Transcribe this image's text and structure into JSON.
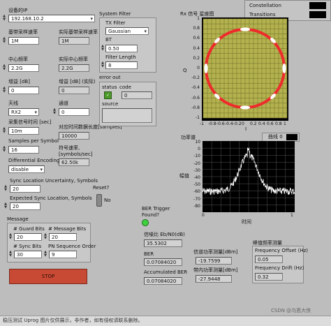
{
  "left": {
    "device_ip": {
      "label": "设备的IP",
      "value": "192.168.10.2"
    },
    "baseband_rate": {
      "label": "基带采样速率",
      "value": "1M"
    },
    "actual_baseband_rate": {
      "label": "实际基带采样速率",
      "value": "1M"
    },
    "center_freq": {
      "label": "中心频率",
      "value": "2.2G"
    },
    "actual_center_freq": {
      "label": "实际中心频率",
      "value": "2.2G"
    },
    "gain": {
      "label": "增益 [dB]",
      "value": "0"
    },
    "actual_gain": {
      "label": "增益 [dB] (实际)",
      "value": "0"
    },
    "antenna": {
      "label": "天线",
      "value": "RX2"
    },
    "channel": {
      "label": "通道",
      "value": "0"
    },
    "capture_time": {
      "label": "采集信号时间 [sec]",
      "value": "10m"
    },
    "record_length": {
      "label": "对应时间数据长度[samples]",
      "value": "10000"
    },
    "samples_per_symbol": {
      "label": "Samples per Symbol",
      "value": "16"
    },
    "symbol_rate": {
      "label": "符号速率,\n[symbols/sec]",
      "value": "62.50k"
    },
    "diff_encoding": {
      "label": "Differential Encoding",
      "value": "disable"
    },
    "sync_uncertainty": {
      "label": "Sync Location Uncertainty, Symbols",
      "value": "20"
    },
    "reset": {
      "label": "Reset?",
      "state": "No"
    },
    "expected_sync": {
      "label": "Expected Sync Location, Symbols",
      "value": "20"
    }
  },
  "message": {
    "title": "Message",
    "guard_bits": {
      "label": "# Guard Bits",
      "value": "20"
    },
    "message_bits": {
      "label": "# Message Bits",
      "value": "20"
    },
    "sync_bits": {
      "label": "# Sync Bits",
      "value": "30"
    },
    "pn_order": {
      "label": "PN Sequence Order",
      "value": "9"
    }
  },
  "stop_label": "STOP",
  "filter": {
    "title": "System Filter",
    "tx_label": "TX Filter",
    "tx_value": "Gaussian",
    "bt_label": "BT",
    "bt_value": "0.50",
    "len_label": "Filter Length",
    "len_value": "8"
  },
  "error": {
    "title": "error out",
    "status_label": "status",
    "code_label": "code",
    "code_value": "0",
    "source_label": "source"
  },
  "constellation": {
    "title": "Rx 信号 星座图",
    "legend": [
      "Constellation",
      "Transitions"
    ],
    "ylabel": "Q",
    "xlabel": "I",
    "xticks": [
      "-1",
      "-0.8",
      "-0.6",
      "-0.4",
      "-0.2",
      "0",
      "0.2",
      "0.4",
      "0.6",
      "0.8",
      "1"
    ],
    "yticks": [
      "1",
      "0.8",
      "0.6",
      "0.4",
      "0.2",
      "0",
      "-0.2",
      "-0.4",
      "-0.6",
      "-0.8",
      "-1"
    ]
  },
  "spectrum": {
    "title": "功率谱",
    "legend": "曲线 0",
    "ylabel": "幅值",
    "xlabel": "时间",
    "xticks": [
      "0",
      "1"
    ],
    "yticks": [
      "10",
      "0",
      "-10",
      "-20",
      "-30",
      "-40",
      "-50",
      "-60",
      "-70",
      "-80"
    ]
  },
  "ber": {
    "trigger_label": "BER Trigger\nFound?",
    "snr": {
      "label": "信噪比 Eb/N0(dB)",
      "value": "35.5302"
    },
    "ber": {
      "label": "BER",
      "value": "0.07084020"
    },
    "acc_ber": {
      "label": "Accumulated BER",
      "value": "0.07084020"
    },
    "power": {
      "label": "信道功率测量[dBm]",
      "value": "-19.7599"
    },
    "adj_power": {
      "label": "带内功率测量[dBm]",
      "value": "-27.9448"
    }
  },
  "freq": {
    "title": "峰值频率测量",
    "offset": {
      "label": "Frequency Offset (Hz)",
      "value": "0.05"
    },
    "drift": {
      "label": "Frequency Drift (Hz)",
      "value": "0.32"
    }
  },
  "footer": {
    "watermark": "CSDN @乌恩大侠",
    "status_text": "稳压测试 Uprog 图片仅供展示，非作者，如有侵权请联系删除。"
  }
}
